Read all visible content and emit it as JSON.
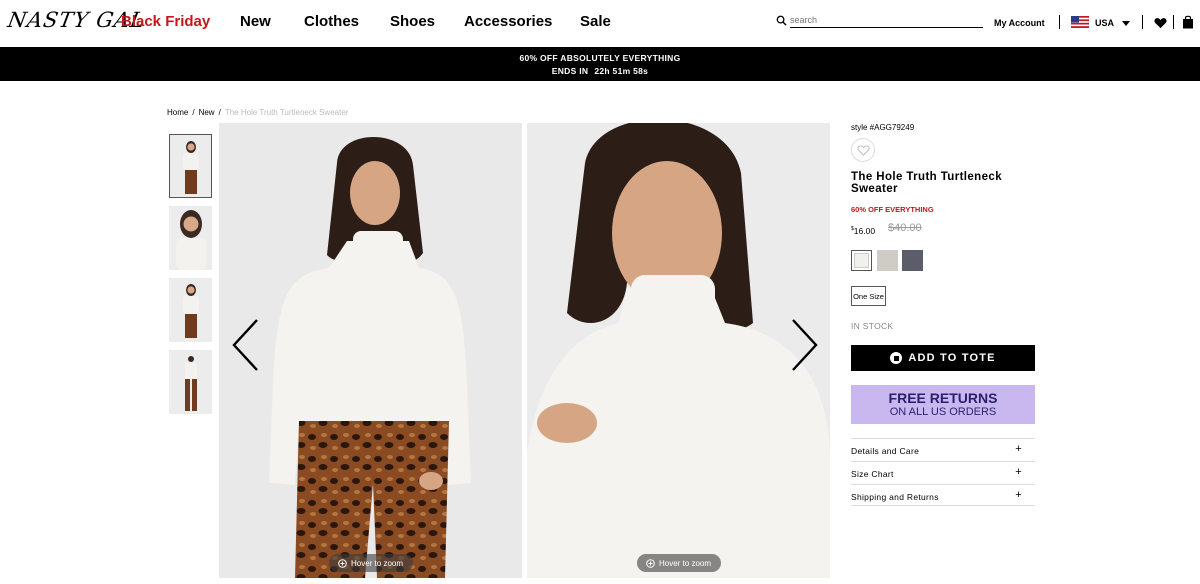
{
  "header": {
    "logo": "NASTY GAL",
    "nav": [
      "Black Friday",
      "New",
      "Clothes",
      "Shoes",
      "Accessories",
      "Sale"
    ],
    "search_placeholder": "search",
    "account": "My Account",
    "country": "USA"
  },
  "promo": {
    "line1": "60% OFF ABSOLUTELY EVERYTHING",
    "ends_label": "ENDS IN",
    "timer": "22h 51m 58s"
  },
  "breadcrumb": [
    "Home",
    "New",
    "The Hole Truth Turtleneck Sweater"
  ],
  "gallery": {
    "zoom_label": "Hover to zoom",
    "thumbnails": 4
  },
  "product": {
    "style": "style #AGG79249",
    "name": "The Hole Truth Turtleneck Sweater",
    "sale_note": "60% OFF EVERYTHING",
    "price_currency": "$",
    "price_value": "16.00",
    "original_price": "$40.00",
    "colors": [
      "#f1f0ec",
      "#cfccc6",
      "#5b5e6a"
    ],
    "size": "One Size",
    "stock": "IN STOCK",
    "add_to_tote": "ADD TO TOTE",
    "returns_line1": "FREE RETURNS",
    "returns_line2": "ON ALL US ORDERS",
    "accordion": [
      "Details and Care",
      "Size Chart",
      "Shipping and Returns"
    ]
  },
  "colors": {
    "accent_red": "#c4161c",
    "returns_bg": "#c9b8f0"
  }
}
